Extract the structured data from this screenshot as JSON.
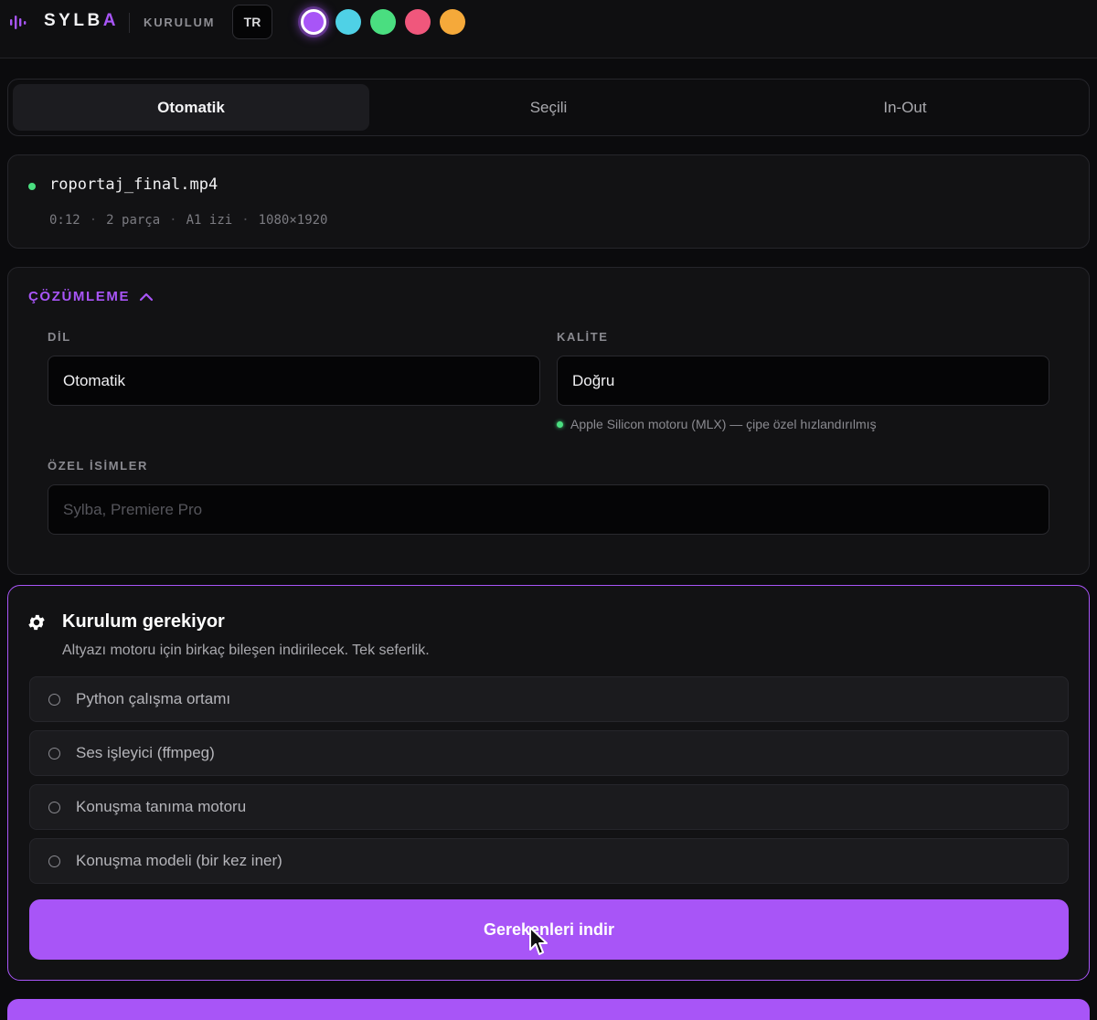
{
  "header": {
    "brand_main": "SYLB",
    "brand_accent": "A",
    "section_label": "KURULUM",
    "language_button": "TR",
    "logo_icon": "audio-waveform-icon",
    "theme_swatches": [
      {
        "name": "purple",
        "color": "#a855f7",
        "selected": true
      },
      {
        "name": "cyan",
        "color": "#4fd1e6",
        "selected": false
      },
      {
        "name": "green",
        "color": "#4ade80",
        "selected": false
      },
      {
        "name": "pink",
        "color": "#f0577c",
        "selected": false
      },
      {
        "name": "orange",
        "color": "#f5a93a",
        "selected": false
      }
    ]
  },
  "tabs": [
    {
      "label": "Otomatik",
      "active": true
    },
    {
      "label": "Seçili",
      "active": false
    },
    {
      "label": "In-Out",
      "active": false
    }
  ],
  "file": {
    "name": "roportaj_final.mp4",
    "status_color": "#4ade80",
    "duration": "0:12",
    "parts": "2 parça",
    "track": "A1 izi",
    "resolution": "1080×1920"
  },
  "resolution": {
    "title": "ÇÖZÜMLEME",
    "toggle_icon": "chevron-up-icon",
    "language_label": "DİL",
    "language_value": "Otomatik",
    "quality_label": "KALİTE",
    "quality_value": "Doğru",
    "engine_hint": "Apple Silicon motoru (MLX) — çipe özel hızlandırılmış",
    "names_label": "ÖZEL İSİMLER",
    "names_placeholder": "Sylba, Premiere Pro"
  },
  "setup": {
    "icon": "gear-icon",
    "title": "Kurulum gerekiyor",
    "description": "Altyazı motoru için birkaç bileşen indirilecek. Tek seferlik.",
    "requirements": [
      {
        "label": "Python çalışma ortamı"
      },
      {
        "label": "Ses işleyici (ffmpeg)"
      },
      {
        "label": "Konuşma tanıma motoru"
      },
      {
        "label": "Konuşma modeli (bir kez iner)"
      }
    ],
    "download_button": "Gerekenleri indir"
  },
  "colors": {
    "accent": "#a855f7",
    "background": "#0b0b0d",
    "panel": "#121214",
    "status_green": "#4ade80"
  }
}
